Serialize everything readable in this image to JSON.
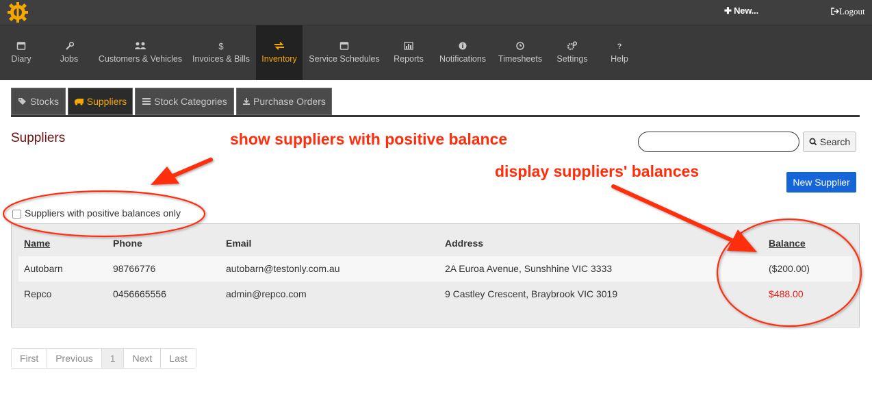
{
  "topbar": {
    "new_label": "✚ New...",
    "logout_label": "Logout"
  },
  "nav": [
    {
      "label": "Diary",
      "icon": "calendar-icon"
    },
    {
      "label": "Jobs",
      "icon": "wrench-icon"
    },
    {
      "label": "Customers & Vehicles",
      "icon": "users-icon"
    },
    {
      "label": "Invoices & Bills",
      "icon": "dollar-icon"
    },
    {
      "label": "Inventory",
      "icon": "exchange-icon",
      "active": true
    },
    {
      "label": "Service Schedules",
      "icon": "calendar-icon"
    },
    {
      "label": "Reports",
      "icon": "chart-icon"
    },
    {
      "label": "Notifications",
      "icon": "info-icon"
    },
    {
      "label": "Timesheets",
      "icon": "clock-icon"
    },
    {
      "label": "Settings",
      "icon": "cogs-icon"
    },
    {
      "label": "Help",
      "icon": "question-icon"
    }
  ],
  "tabs": [
    {
      "label": "Stocks",
      "icon": "tags-icon"
    },
    {
      "label": "Suppliers",
      "icon": "truck-icon",
      "active": true
    },
    {
      "label": "Stock Categories",
      "icon": "list-icon"
    },
    {
      "label": "Purchase Orders",
      "icon": "download-icon"
    }
  ],
  "page": {
    "title": "Suppliers"
  },
  "search": {
    "value": "",
    "button_label": "Search"
  },
  "new_supplier_label": "New Supplier",
  "filter": {
    "label": "Suppliers with positive balances only",
    "checked": false
  },
  "table": {
    "headers": {
      "name": "Name",
      "phone": "Phone",
      "email": "Email",
      "address": "Address",
      "balance": "Balance"
    },
    "rows": [
      {
        "name": "Autobarn",
        "phone": "98766776",
        "email": "autobarn@testonly.com.au",
        "address": "2A Euroa Avenue, Sunshhine VIC 3333",
        "balance": "($200.00)"
      },
      {
        "name": "Repco",
        "phone": "0456665556",
        "email": "admin@repco.com",
        "address": "9 Castley Crescent, Braybrook VIC 3019",
        "balance": "$488.00"
      }
    ]
  },
  "pagination": {
    "first": "First",
    "previous": "Previous",
    "current": "1",
    "next": "Next",
    "last": "Last"
  },
  "annotations": {
    "filter_note": "show suppliers with positive balance",
    "balance_note": "display suppliers' balances"
  },
  "colors": {
    "accent": "#f7a800",
    "annotation": "#ff2d0c",
    "positive_balance": "#e0201c",
    "primary_button": "#1565d8"
  }
}
